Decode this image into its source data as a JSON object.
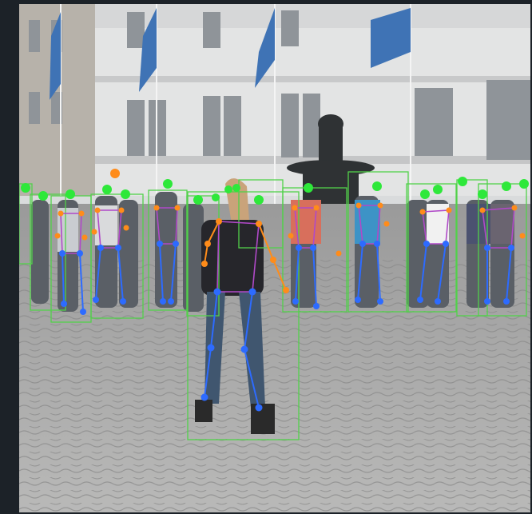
{
  "image": {
    "description_tag": "pose-estimation-overlay",
    "colors": {
      "bbox": "#52d14a",
      "head_keypoint": "#2ee83a",
      "upper_keypoint": "#ff8c1a",
      "lower_keypoint": "#2d6bff",
      "torso_link": "#b049c8"
    }
  }
}
